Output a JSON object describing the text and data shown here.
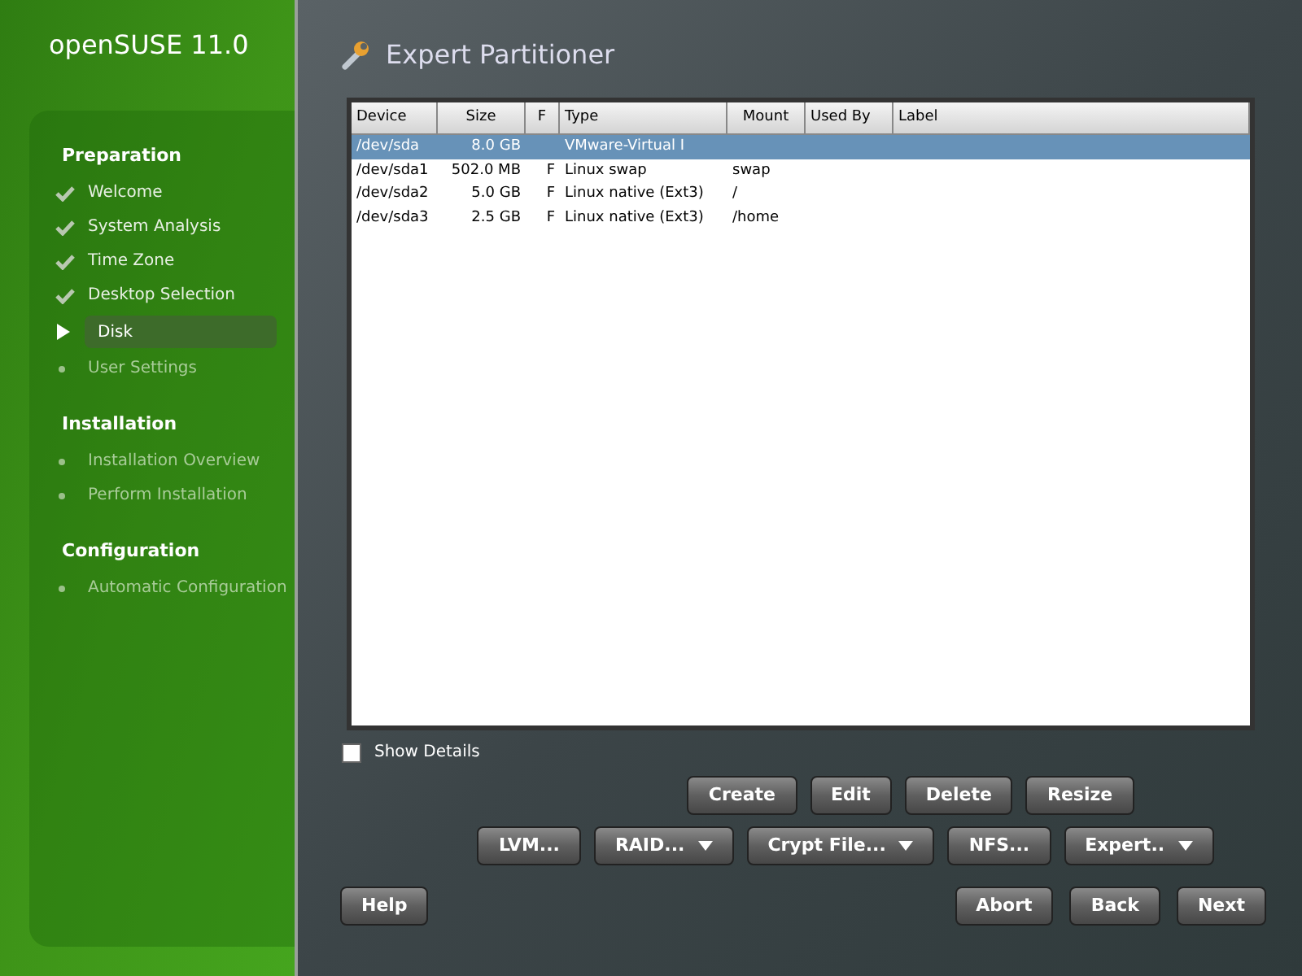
{
  "brand": "openSUSE 11.0",
  "steps": [
    {
      "kind": "section",
      "label": "Preparation"
    },
    {
      "kind": "done",
      "label": "Welcome"
    },
    {
      "kind": "done",
      "label": "System Analysis"
    },
    {
      "kind": "done",
      "label": "Time Zone"
    },
    {
      "kind": "done",
      "label": "Desktop Selection"
    },
    {
      "kind": "current",
      "label": "Disk"
    },
    {
      "kind": "pending",
      "label": "User Settings"
    },
    {
      "kind": "section",
      "label": "Installation"
    },
    {
      "kind": "pending",
      "label": "Installation Overview"
    },
    {
      "kind": "pending",
      "label": "Perform Installation"
    },
    {
      "kind": "section",
      "label": "Configuration"
    },
    {
      "kind": "pending",
      "label": "Automatic Configuration"
    }
  ],
  "title": "Expert Partitioner",
  "table": {
    "columns": [
      {
        "label": "Device"
      },
      {
        "label": "Size"
      },
      {
        "label": "F"
      },
      {
        "label": "Type"
      },
      {
        "label": "Mount"
      },
      {
        "label": "Used By"
      },
      {
        "label": "Label"
      }
    ],
    "rows": [
      {
        "selected": true,
        "cells": [
          "/dev/sda",
          "8.0 GB",
          "",
          "VMware-Virtual I",
          "",
          "",
          ""
        ]
      },
      {
        "selected": false,
        "cells": [
          "/dev/sda1",
          "502.0 MB",
          "F",
          "Linux swap",
          "swap",
          "",
          ""
        ]
      },
      {
        "selected": false,
        "cells": [
          "/dev/sda2",
          "5.0 GB",
          "F",
          "Linux native (Ext3)",
          "/",
          "",
          ""
        ]
      },
      {
        "selected": false,
        "cells": [
          "/dev/sda3",
          "2.5 GB",
          "F",
          "Linux native (Ext3)",
          "/home",
          "",
          ""
        ]
      }
    ]
  },
  "show_details": {
    "label": "Show Details",
    "checked": false
  },
  "button_rows": [
    [
      {
        "label": "Create",
        "menu": false
      },
      {
        "label": "Edit",
        "menu": false
      },
      {
        "label": "Delete",
        "menu": false
      },
      {
        "label": "Resize",
        "menu": false
      }
    ],
    [
      {
        "label": "LVM...",
        "menu": false
      },
      {
        "label": "RAID...",
        "menu": true
      },
      {
        "label": "Crypt File...",
        "menu": true
      },
      {
        "label": "NFS...",
        "menu": false
      },
      {
        "label": "Expert..",
        "menu": true
      }
    ]
  ],
  "footer_left": [
    {
      "label": "Help"
    }
  ],
  "footer_right": [
    {
      "label": "Abort"
    },
    {
      "label": "Back"
    },
    {
      "label": "Next"
    }
  ]
}
